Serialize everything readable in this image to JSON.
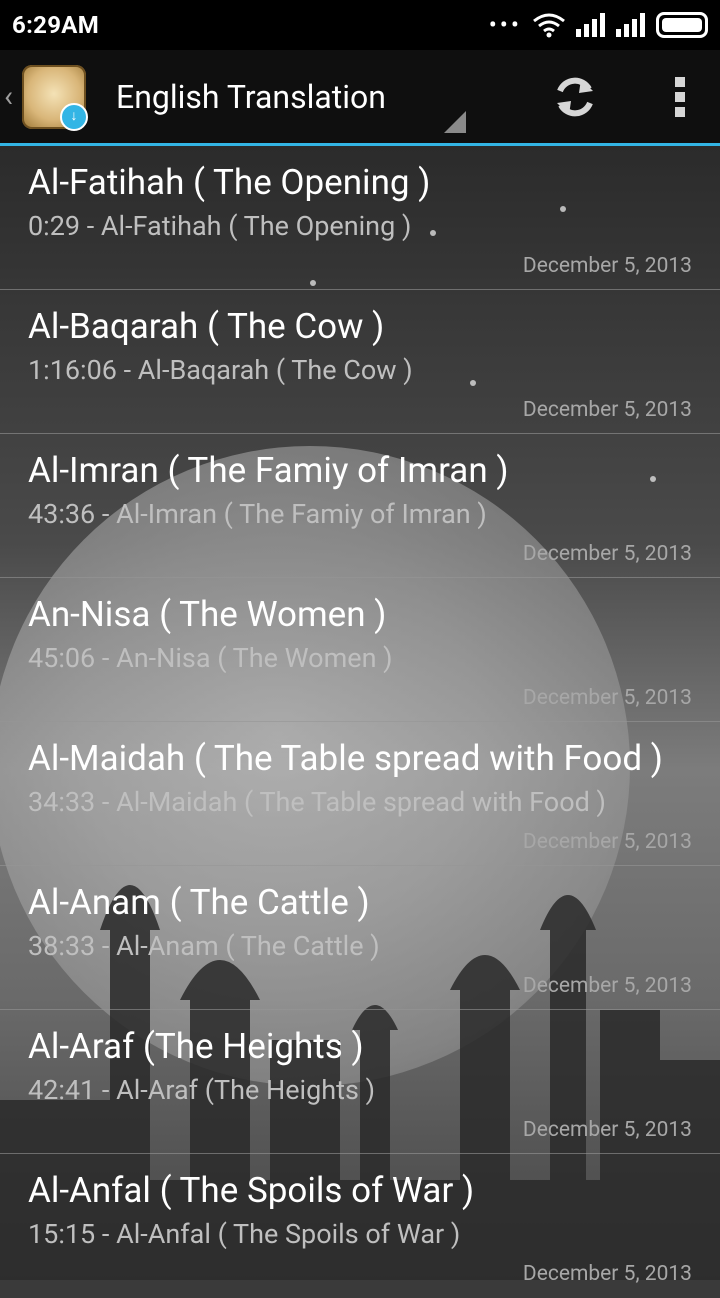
{
  "status_bar": {
    "time": "6:29AM",
    "dots": "•••"
  },
  "action_bar": {
    "up_caret": "‹",
    "title": "English Translation",
    "icons": [
      "app-icon",
      "refresh-icon",
      "overflow-menu-icon"
    ]
  },
  "list": [
    {
      "title": "Al-Fatihah ( The Opening )",
      "subtitle": "0:29 - Al-Fatihah ( The Opening )",
      "date": "December 5, 2013"
    },
    {
      "title": "Al-Baqarah ( The Cow )",
      "subtitle": "1:16:06 - Al-Baqarah ( The Cow )",
      "date": "December 5, 2013"
    },
    {
      "title": "Al-Imran ( The Famiy of Imran )",
      "subtitle": "43:36 - Al-Imran ( The Famiy of Imran )",
      "date": "December 5, 2013"
    },
    {
      "title": "An-Nisa ( The Women )",
      "subtitle": "45:06 - An-Nisa ( The Women )",
      "date": "December 5, 2013"
    },
    {
      "title": "Al-Maidah ( The Table spread with Food )",
      "subtitle": "34:33 - Al-Maidah ( The Table spread with Food )",
      "date": "December 5, 2013"
    },
    {
      "title": "Al-Anam ( The Cattle )",
      "subtitle": "38:33 - Al-Anam ( The Cattle )",
      "date": "December 5, 2013"
    },
    {
      "title": "Al-Araf (The Heights )",
      "subtitle": "42:41 - Al-Araf (The Heights )",
      "date": "December 5, 2013"
    },
    {
      "title": "Al-Anfal ( The Spoils of War )",
      "subtitle": "15:15 - Al-Anfal ( The Spoils of War )",
      "date": "December 5, 2013"
    }
  ],
  "colors": {
    "accent": "#33b5e5",
    "action_bar": "#0f0f0f",
    "status_bar": "#000000"
  }
}
